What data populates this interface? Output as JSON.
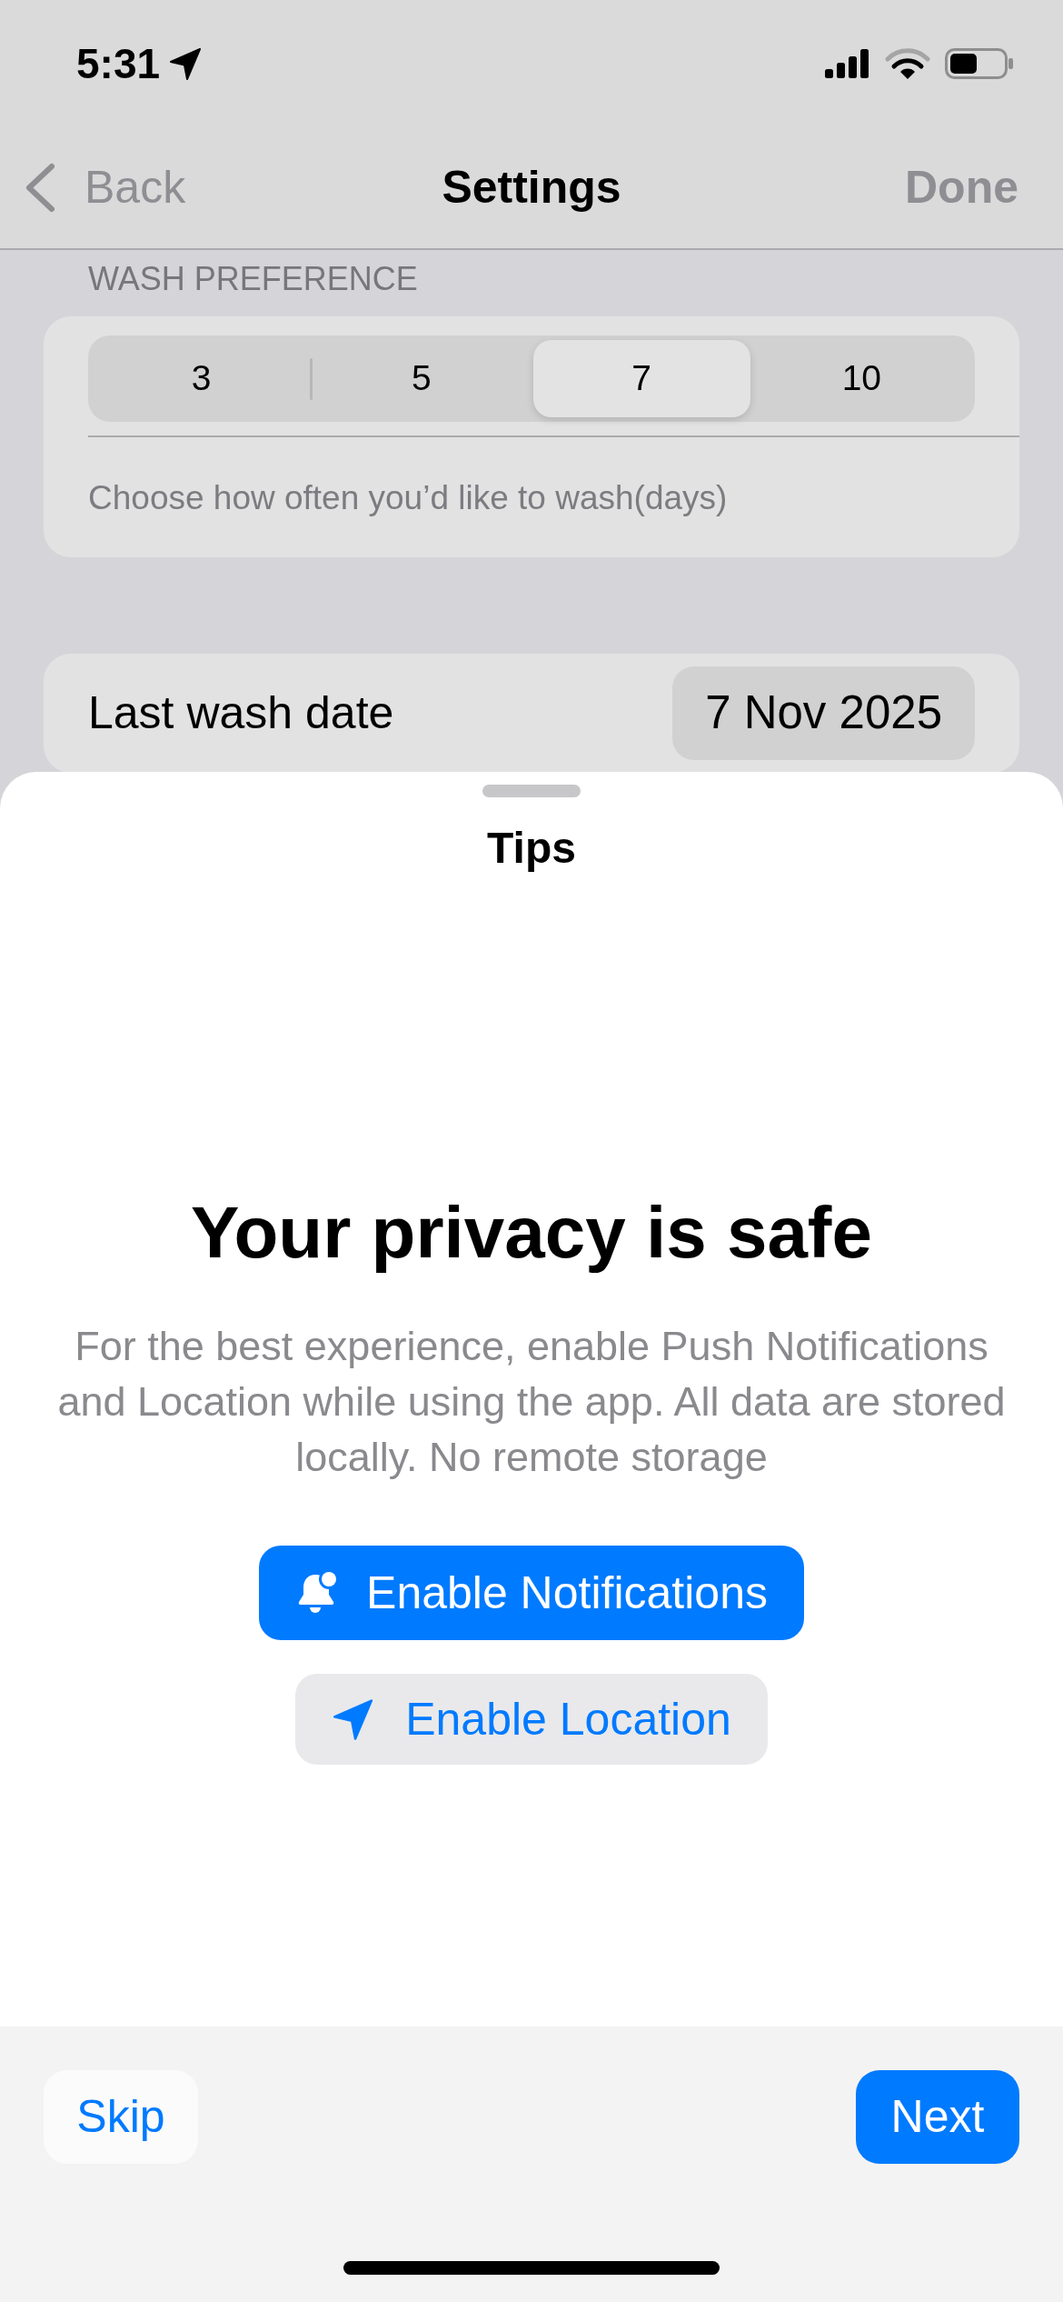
{
  "status_bar": {
    "time": "5:31"
  },
  "nav_bar": {
    "back": "Back",
    "title": "Settings",
    "done": "Done"
  },
  "wash_preference": {
    "header": "WASH PREFERENCE",
    "segments": [
      {
        "label": "3",
        "selected": false
      },
      {
        "label": "5",
        "selected": false
      },
      {
        "label": "7",
        "selected": true
      },
      {
        "label": "10",
        "selected": false
      }
    ],
    "footer": "Choose how often you’d like to wash(days)"
  },
  "last_wash": {
    "label": "Last wash date",
    "value": "7 Nov 2025"
  },
  "sheet": {
    "title": "Tips",
    "heading": "Your privacy is safe",
    "body": "For the best experience, enable Push Notifications and Location while using the app. All data are stored locally. No remote storage",
    "notifications_button": "Enable Notifications",
    "location_button": "Enable Location"
  },
  "footer": {
    "skip": "Skip",
    "next": "Next"
  }
}
